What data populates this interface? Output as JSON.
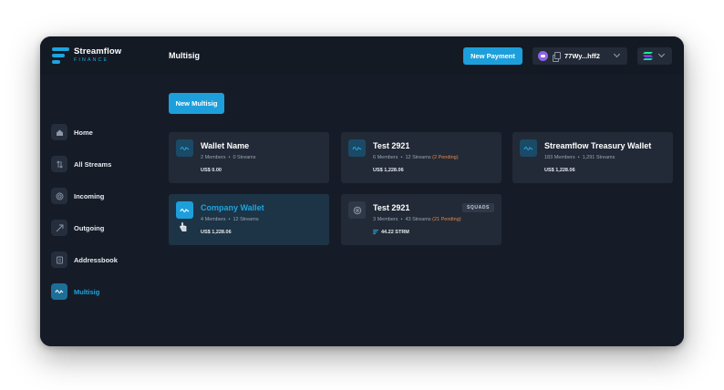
{
  "brand": {
    "name": "Streamflow",
    "subtitle": "FINANCE"
  },
  "header": {
    "title": "Multisig",
    "new_payment_label": "New Payment",
    "wallet_address": "77Wy...hff2"
  },
  "sidebar": {
    "items": [
      {
        "label": "Home",
        "icon": "home-icon"
      },
      {
        "label": "All Streams",
        "icon": "streams-icon"
      },
      {
        "label": "Incoming",
        "icon": "incoming-icon"
      },
      {
        "label": "Outgoing",
        "icon": "outgoing-icon"
      },
      {
        "label": "Addressbook",
        "icon": "addressbook-icon"
      },
      {
        "label": "Multisig",
        "icon": "multisig-icon",
        "active": true
      }
    ]
  },
  "main": {
    "new_multisig_label": "New Multisig",
    "cards": [
      {
        "title": "Wallet Name",
        "members": "2 Members",
        "streams": "0 Streams",
        "pending": "",
        "value": "US$ 0.00"
      },
      {
        "title": "Test 2921",
        "members": "6 Members",
        "streams": "12 Streams",
        "pending": "(2 Pending)",
        "value": "US$ 1,228.06"
      },
      {
        "title": "Streamflow Treasury Wallet",
        "members": "183 Members",
        "streams": "1,291 Streams",
        "pending": "",
        "value": "US$ 1,228.06"
      },
      {
        "title": "Company Wallet",
        "members": "4 Members",
        "streams": "12 Streams",
        "pending": "",
        "value": "US$ 1,228.06",
        "selected": true
      },
      {
        "title": "Test 2921",
        "members": "3 Members",
        "streams": "43 Streams",
        "pending": "(21 Pending)",
        "value": "44.22 STRM",
        "badge": "SQUADS"
      }
    ],
    "separator": "•"
  },
  "colors": {
    "accent": "#1d9fdb",
    "background": "#161c27",
    "card": "#222a37",
    "pending": "#e28a4f"
  }
}
